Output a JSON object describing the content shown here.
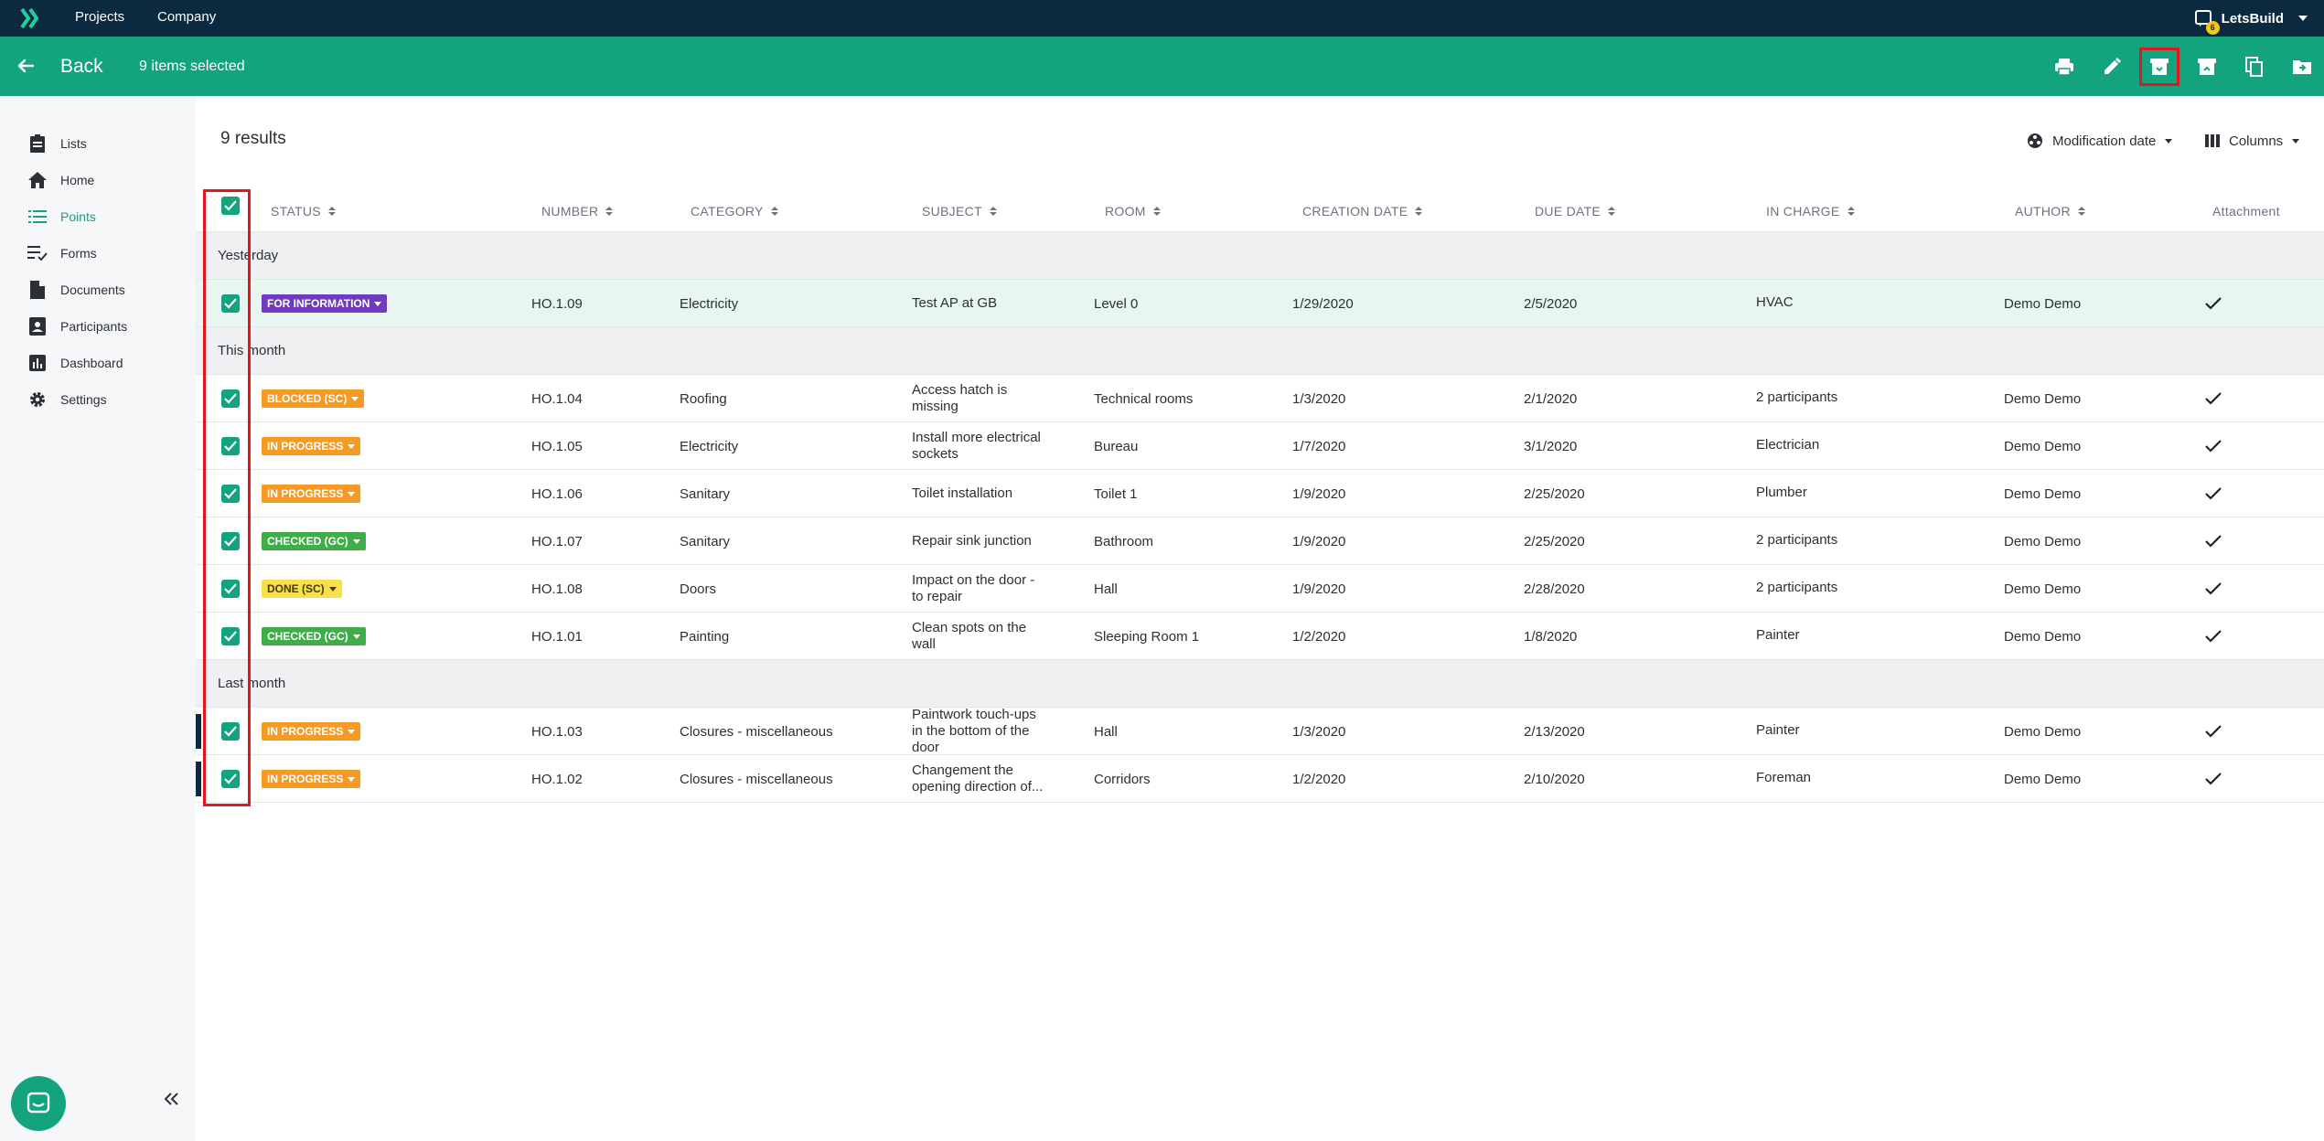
{
  "topnav": {
    "projects": "Projects",
    "company": "Company",
    "user": "LetsBuild",
    "notif_count": "6"
  },
  "actionbar": {
    "back": "Back",
    "selected": "9 items selected",
    "icons": [
      "print-icon",
      "edit-icon",
      "archive-icon",
      "unarchive-icon",
      "copy-icon",
      "move-to-folder-icon"
    ]
  },
  "sidebar": {
    "items": [
      {
        "label": "Lists",
        "icon": "clipboard-icon"
      },
      {
        "label": "Home",
        "icon": "home-icon"
      },
      {
        "label": "Points",
        "icon": "list-icon"
      },
      {
        "label": "Forms",
        "icon": "form-check-icon"
      },
      {
        "label": "Documents",
        "icon": "document-icon"
      },
      {
        "label": "Participants",
        "icon": "participants-icon"
      },
      {
        "label": "Dashboard",
        "icon": "chart-icon"
      },
      {
        "label": "Settings",
        "icon": "gear-icon"
      }
    ]
  },
  "main": {
    "results": "9 results",
    "sort_label": "Modification date",
    "columns_label": "Columns"
  },
  "table": {
    "headers": {
      "status": "STATUS",
      "number": "NUMBER",
      "category": "CATEGORY",
      "subject": "SUBJECT",
      "room": "ROOM",
      "creation": "CREATION DATE",
      "due": "DUE DATE",
      "incharge": "IN CHARGE",
      "author": "AUTHOR",
      "attachment": "Attachment"
    },
    "groups": {
      "yesterday": "Yesterday",
      "this_month": "This month",
      "last_month": "Last month"
    },
    "rows": [
      {
        "status": "FOR INFORMATION",
        "color": "#6f3bbf",
        "number": "HO.1.09",
        "category": "Electricity",
        "subject": "Test AP at GB",
        "room": "Level 0",
        "creation": "1/29/2020",
        "due": "2/5/2020",
        "incharge": "HVAC",
        "author": "Demo Demo"
      },
      {
        "status": "BLOCKED (SC)",
        "color": "#f59a23",
        "number": "HO.1.04",
        "category": "Roofing",
        "subject": "Access hatch is missing",
        "room": "Technical rooms",
        "creation": "1/3/2020",
        "due": "2/1/2020",
        "incharge": "2 participants",
        "author": "Demo Demo"
      },
      {
        "status": "IN PROGRESS",
        "color": "#f59a23",
        "number": "HO.1.05",
        "category": "Electricity",
        "subject": "Install more electrical sockets",
        "room": "Bureau",
        "creation": "1/7/2020",
        "due": "3/1/2020",
        "incharge": "Electrician",
        "author": "Demo Demo"
      },
      {
        "status": "IN PROGRESS",
        "color": "#f59a23",
        "number": "HO.1.06",
        "category": "Sanitary",
        "subject": "Toilet installation",
        "room": "Toilet 1",
        "creation": "1/9/2020",
        "due": "2/25/2020",
        "incharge": "Plumber",
        "author": "Demo Demo"
      },
      {
        "status": "CHECKED (GC)",
        "color": "#3fae49",
        "number": "HO.1.07",
        "category": "Sanitary",
        "subject": "Repair sink junction",
        "room": "Bathroom",
        "creation": "1/9/2020",
        "due": "2/25/2020",
        "incharge": "2 participants",
        "author": "Demo Demo"
      },
      {
        "status": "DONE (SC)",
        "color": "#f7e04b",
        "number": "HO.1.08",
        "category": "Doors",
        "subject": "Impact on the door - to repair",
        "room": "Hall",
        "creation": "1/9/2020",
        "due": "2/28/2020",
        "incharge": "2 participants",
        "author": "Demo Demo"
      },
      {
        "status": "CHECKED (GC)",
        "color": "#3fae49",
        "number": "HO.1.01",
        "category": "Painting",
        "subject": "Clean spots on the wall",
        "room": "Sleeping Room 1",
        "creation": "1/2/2020",
        "due": "1/8/2020",
        "incharge": "Painter",
        "author": "Demo Demo"
      },
      {
        "status": "IN PROGRESS",
        "color": "#f59a23",
        "number": "HO.1.03",
        "category": "Closures - miscellaneous",
        "subject": "Paintwork touch-ups in the bottom of the door",
        "room": "Hall",
        "creation": "1/3/2020",
        "due": "2/13/2020",
        "incharge": "Painter",
        "author": "Demo Demo"
      },
      {
        "status": "IN PROGRESS",
        "color": "#f59a23",
        "number": "HO.1.02",
        "category": "Closures - miscellaneous",
        "subject": "Changement the opening direction of...",
        "room": "Corridors",
        "creation": "1/2/2020",
        "due": "2/10/2020",
        "incharge": "Foreman",
        "author": "Demo Demo"
      }
    ]
  }
}
